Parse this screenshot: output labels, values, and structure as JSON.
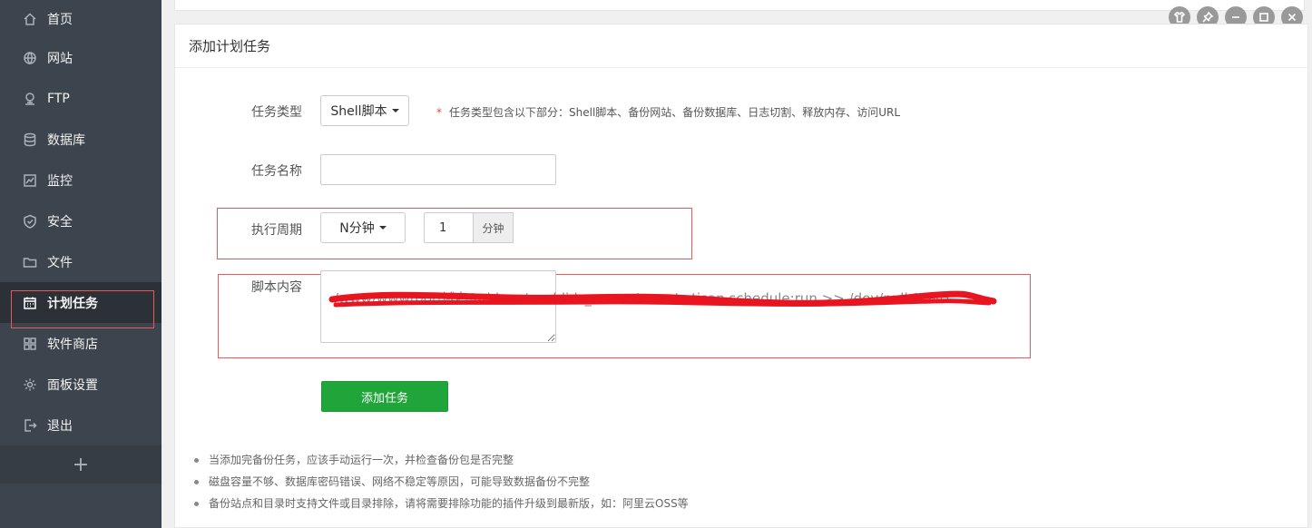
{
  "sidebar": {
    "items": [
      {
        "label": "首页",
        "icon": "home-icon"
      },
      {
        "label": "网站",
        "icon": "globe-icon"
      },
      {
        "label": "FTP",
        "icon": "ftp-icon"
      },
      {
        "label": "数据库",
        "icon": "database-icon"
      },
      {
        "label": "监控",
        "icon": "monitor-icon"
      },
      {
        "label": "安全",
        "icon": "shield-icon"
      },
      {
        "label": "文件",
        "icon": "folder-icon"
      },
      {
        "label": "计划任务",
        "icon": "calendar-icon",
        "active": true
      },
      {
        "label": "软件商店",
        "icon": "apps-icon"
      },
      {
        "label": "面板设置",
        "icon": "gear-icon"
      },
      {
        "label": "退出",
        "icon": "logout-icon"
      }
    ],
    "add_label": "+"
  },
  "panel": {
    "title": "添加计划任务"
  },
  "form": {
    "task_type": {
      "label": "任务类型",
      "value": "Shell脚本",
      "hint": "任务类型包含以下部分：Shell脚本、备份网站、备份数据库、日志切割、释放内存、访问URL",
      "hint_star": "*"
    },
    "task_name": {
      "label": "任务名称",
      "value": ""
    },
    "cycle": {
      "label": "执行周期",
      "value": "N分钟",
      "minutes": "1",
      "unit": "分钟"
    },
    "script": {
      "label": "脚本内容",
      "value": "/www/wwwroot/域名/addons/worldids_comm/cerm/artisan schedule:run >> /dev/null 2>&1"
    },
    "submit_label": "添加任务"
  },
  "tips": [
    "当添加完备份任务，应该手动运行一次，并检查备份包是否完整",
    "磁盘容量不够、数据库密码错误、网络不稳定等原因，可能导致数据备份不完整",
    "备份站点和目录时支持文件或目录排除，请将需要排除功能的插件升级到最新版，如：阿里云OSS等"
  ],
  "colors": {
    "sidebar_bg": "#3c444d",
    "sidebar_active": "#2c3138",
    "primary_green": "#20a53a",
    "annotation_red": "#e55a5a"
  },
  "window_controls": [
    "theme-icon",
    "pin-icon",
    "minimize-icon",
    "maximize-icon",
    "close-icon"
  ]
}
